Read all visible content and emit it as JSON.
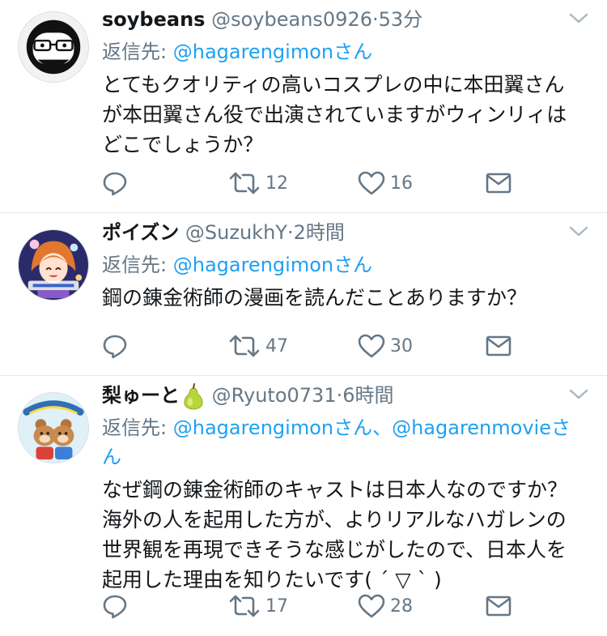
{
  "tweets": [
    {
      "name": "soybeans",
      "handle": "@soybeans0926",
      "dot": "·",
      "time": "53分",
      "reply_prefix": "返信先:",
      "mentions": "@hagarengimonさん",
      "text": "とてもクオリティの高いコスプレの中に本田翼さん\nが本田翼さん役で出演されていますがウィンリィは\nどこでしょうか？",
      "retweets": "12",
      "likes": "16"
    },
    {
      "name": "ポイズン",
      "handle": "@SuzukhY",
      "dot": "·",
      "time": "2時間",
      "reply_prefix": "返信先:",
      "mentions": "@hagarengimonさん",
      "text": "鋼の錬金術師の漫画を読んだことありますか？",
      "retweets": "47",
      "likes": "30"
    },
    {
      "name": "梨ゅーと",
      "name_icon": "pear-icon",
      "handle": "@Ryuto0731",
      "dot": "·",
      "time": "6時間",
      "reply_prefix": "返信先:",
      "mentions": "@hagarengimonさん、@hagarenmovieさ\nん",
      "text": "なぜ鋼の錬金術師のキャストは日本人なのですか？\n海外の人を起用した方が、よりリアルなハガレンの\n世界観を再現できそうな感じがしたので、日本人を\n起用した理由を知りたいです( ´ ▽ ` )",
      "retweets": "17",
      "likes": "28"
    }
  ],
  "icons": [
    "chevron-down-icon",
    "reply-icon",
    "retweet-icon",
    "like-icon",
    "message-icon"
  ],
  "colors": {
    "link": "#1da1f2",
    "secondary": "#657786",
    "text": "#14171a",
    "divider": "#e1e8ed"
  }
}
